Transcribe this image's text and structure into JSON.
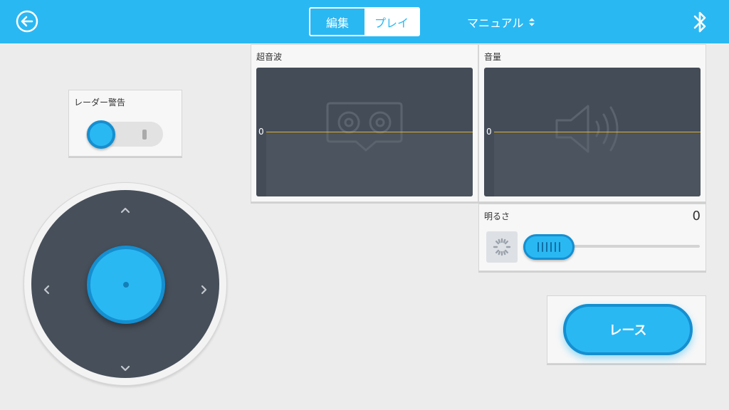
{
  "header": {
    "back_icon": "arrow-left-circle-icon",
    "mode_toggle": {
      "edit_label": "編集",
      "play_label": "プレイ",
      "selected": "プレイ"
    },
    "control_mode": {
      "label": "マニュアル",
      "icon": "up-down-arrows-icon"
    },
    "bluetooth_icon": "bluetooth-icon"
  },
  "radar": {
    "title": "レーダー警告",
    "on": false
  },
  "joystick": {
    "icons": [
      "chevron-up-icon",
      "chevron-down-icon",
      "chevron-left-icon",
      "chevron-right-icon"
    ]
  },
  "ultrasonic": {
    "title": "超音波",
    "axis_label": "0",
    "icon": "ultrasonic-sensor-icon"
  },
  "sound": {
    "title": "音量",
    "axis_label": "0",
    "icon": "speaker-icon"
  },
  "brightness": {
    "title": "明るさ",
    "value": "0",
    "icon": "light-sensor-icon",
    "level": 0
  },
  "race": {
    "label": "レース"
  },
  "colors": {
    "accent": "#2ab8f3",
    "accent_dark": "#158fd0",
    "panel_dark": "#444c58",
    "graph_line": "#e2b63b",
    "background": "#ececec"
  }
}
